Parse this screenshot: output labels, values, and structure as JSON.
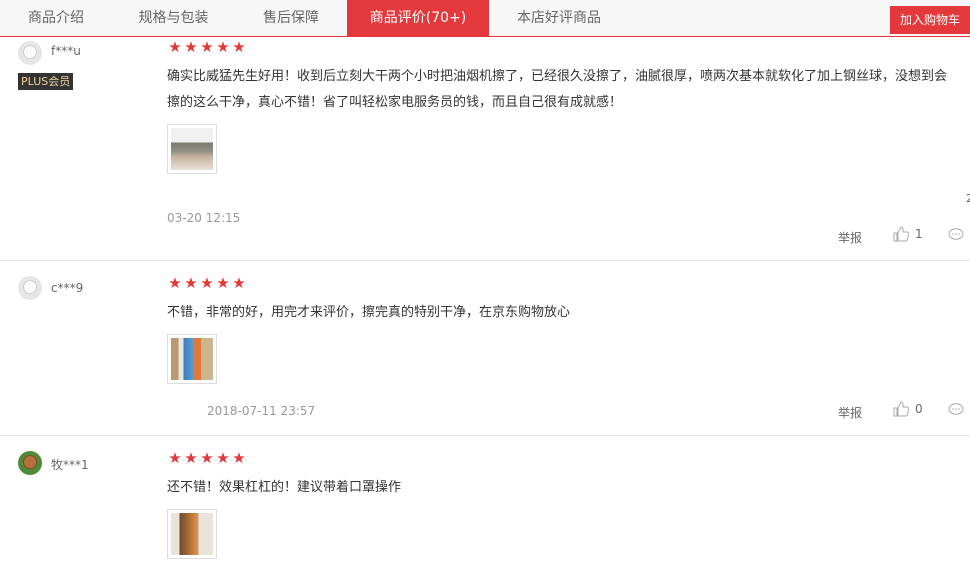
{
  "tabs": [
    {
      "label": "商品介绍"
    },
    {
      "label": "规格与包装"
    },
    {
      "label": "售后保障"
    },
    {
      "label": "商品评价(70+)"
    },
    {
      "label": "本店好评商品"
    }
  ],
  "cart_button": "加入购物车",
  "colors": {
    "accent": "#e4393c",
    "star": "#e4393c"
  },
  "edge_mark": "2",
  "reviews": [
    {
      "user": "f***u",
      "badge": "PLUS会员",
      "rating": 5,
      "content": "确实比威猛先生好用！收到后立刻大干两个小时把油烟机擦了，已经很久没擦了，油腻很厚，喷两次基本就软化了加上钢丝球，没想到会擦的这么干净，真心不错！省了叫轻松家电服务员的钱，而且自己很有成就感！",
      "date": "03-20 12:15",
      "report": "举报",
      "likes": "1"
    },
    {
      "user": "c***9",
      "rating": 5,
      "content": "不错，非常的好，用完才来评价，擦完真的特别干净，在京东购物放心",
      "date": "2018-07-11 23:57",
      "report": "举报",
      "likes": "0"
    },
    {
      "user": "牧***1",
      "rating": 5,
      "content": "还不错！效果杠杠的！建议带着口罩操作"
    }
  ]
}
